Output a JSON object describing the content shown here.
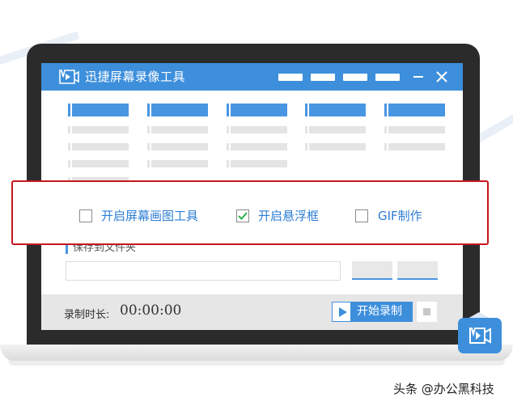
{
  "window": {
    "title": "迅捷屏幕录像工具"
  },
  "options": {
    "items": [
      {
        "label": "开启屏幕画图工具",
        "checked": false
      },
      {
        "label": "开启悬浮框",
        "checked": true
      },
      {
        "label": "GIF制作",
        "checked": false
      }
    ]
  },
  "save": {
    "label": "保存到文件夹",
    "path_value": ""
  },
  "bottom": {
    "duration_label": "录制时长:",
    "duration_value": "00:00:00",
    "start_label": "开始录制"
  },
  "watermark": "头条 @办公黑科技",
  "colors": {
    "accent": "#3d8fdc",
    "highlight_border": "#c9151e",
    "checkmark": "#2bb24c",
    "option_text": "#2f7fd4"
  }
}
